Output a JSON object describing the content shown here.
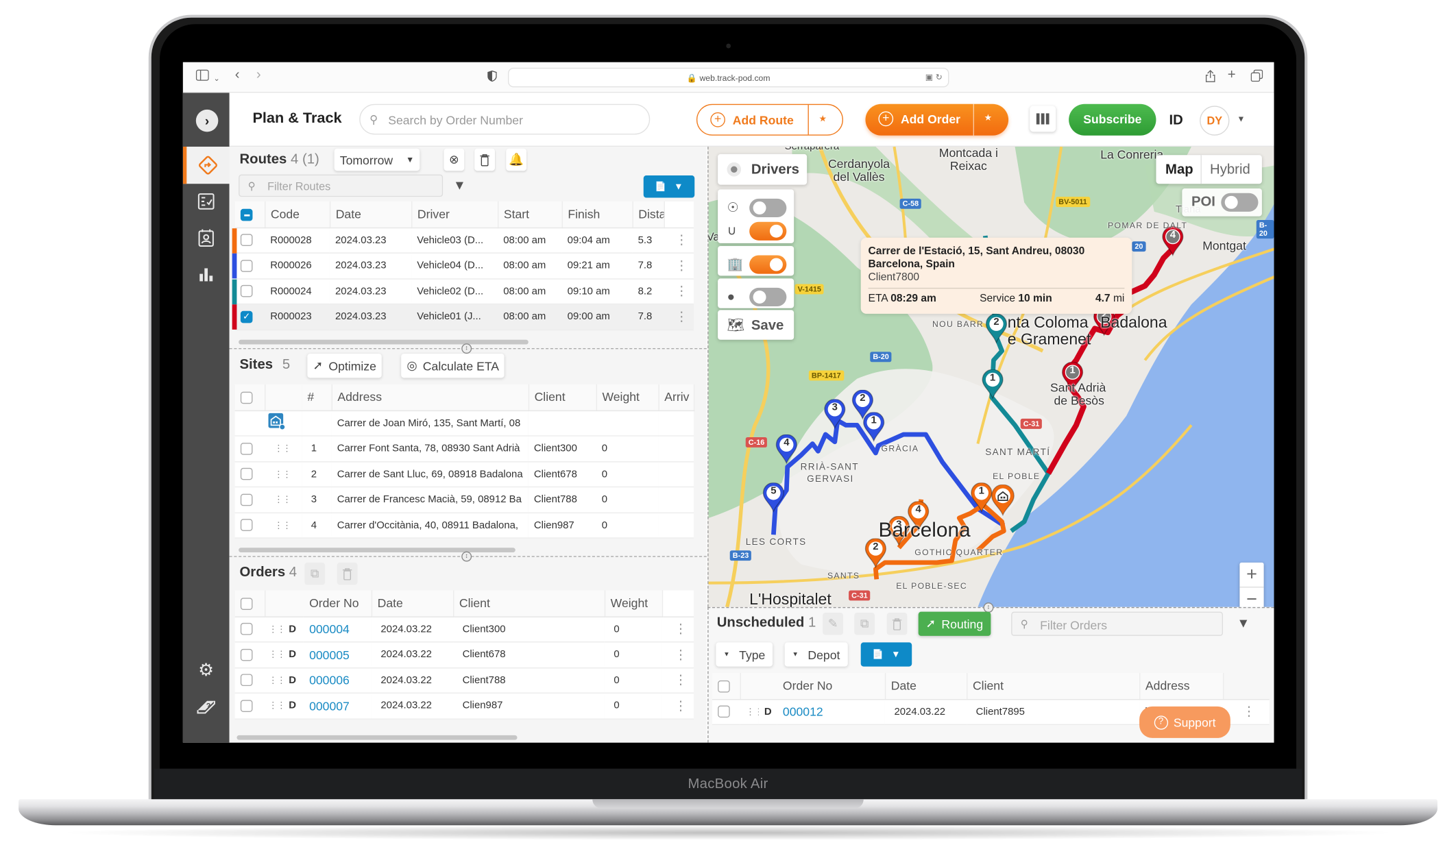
{
  "device": {
    "label": "MacBook Air"
  },
  "browser": {
    "url": "web.track-pod.com",
    "icons": [
      "sidebar-toggle-icon",
      "chevron-down-icon",
      "back-icon",
      "forward-icon",
      "privacy-shield-icon",
      "translate-icon",
      "reload-icon",
      "share-icon",
      "new-tab-icon",
      "tabs-overview-icon"
    ]
  },
  "header": {
    "title": "Plan & Track",
    "search_placeholder": "Search by Order Number",
    "add_route_label": "Add Route",
    "add_order_label": "Add Order",
    "subscribe_label": "Subscribe",
    "id_label": "ID",
    "avatar_initials": "DY",
    "accent_color": "#f07a1c",
    "subscribe_color": "#3aaa3f"
  },
  "sidebar": {
    "items": [
      {
        "name": "routes",
        "icon": "route-diamond-icon",
        "active": true
      },
      {
        "name": "checklist",
        "icon": "checklist-icon",
        "active": false
      },
      {
        "name": "contacts",
        "icon": "contact-card-icon",
        "active": false
      },
      {
        "name": "reports",
        "icon": "bar-chart-icon",
        "active": false
      }
    ],
    "bottom_items": [
      {
        "name": "settings",
        "icon": "gear-icon"
      },
      {
        "name": "help",
        "icon": "help-book-icon"
      }
    ]
  },
  "routes": {
    "title": "Routes",
    "count": "4 (1)",
    "date_filter": "Tomorrow",
    "filter_placeholder": "Filter Routes",
    "columns": [
      "Code",
      "Date",
      "Driver",
      "Start",
      "Finish",
      "Dista"
    ],
    "rows": [
      {
        "color": "#f26b0f",
        "checked": false,
        "code": "R000028",
        "date": "2024.03.23",
        "driver": "Vehicle03 (D...",
        "start": "08:00 am",
        "finish": "09:04 am",
        "distance": "5.3"
      },
      {
        "color": "#2d4fe0",
        "checked": false,
        "code": "R000026",
        "date": "2024.03.23",
        "driver": "Vehicle04 (D...",
        "start": "08:00 am",
        "finish": "09:21 am",
        "distance": "7.8"
      },
      {
        "color": "#138a96",
        "checked": false,
        "code": "R000024",
        "date": "2024.03.23",
        "driver": "Vehicle02 (D...",
        "start": "08:00 am",
        "finish": "09:10 am",
        "distance": "8.2"
      },
      {
        "color": "#d0021b",
        "checked": true,
        "code": "R000023",
        "date": "2024.03.23",
        "driver": "Vehicle01 (J...",
        "start": "08:00 am",
        "finish": "09:00 am",
        "distance": "7.8"
      }
    ]
  },
  "sites": {
    "title": "Sites",
    "count": "5",
    "optimize_label": "Optimize",
    "calculate_eta_label": "Calculate ETA",
    "columns": [
      "#",
      "Address",
      "Client",
      "Weight",
      "Arriv"
    ],
    "depot": {
      "address": "Carrer de Joan Miró, 135, Sant Martí, 08"
    },
    "rows": [
      {
        "num": "1",
        "address": "Carrer Font Santa, 78, 08930 Sant Adrià",
        "client": "Client300",
        "weight": "0"
      },
      {
        "num": "2",
        "address": "Carrer de Sant Lluc, 69, 08918 Badalona",
        "client": "Client678",
        "weight": "0"
      },
      {
        "num": "3",
        "address": "Carrer de Francesc Macià, 59, 08912 Ba",
        "client": "Client788",
        "weight": "0"
      },
      {
        "num": "4",
        "address": "Carrer d'Occitània, 40, 08911 Badalona,",
        "client": "Clien987",
        "weight": "0"
      }
    ]
  },
  "orders": {
    "title": "Orders",
    "count": "4",
    "columns": [
      "Order No",
      "Date",
      "Client",
      "Weight"
    ],
    "rows": [
      {
        "type": "D",
        "order_no": "000004",
        "date": "2024.03.22",
        "client": "Client300",
        "weight": "0"
      },
      {
        "type": "D",
        "order_no": "000005",
        "date": "2024.03.22",
        "client": "Client678",
        "weight": "0"
      },
      {
        "type": "D",
        "order_no": "000006",
        "date": "2024.03.22",
        "client": "Client788",
        "weight": "0"
      },
      {
        "type": "D",
        "order_no": "000007",
        "date": "2024.03.22",
        "client": "Clien987",
        "weight": "0"
      }
    ]
  },
  "map": {
    "drivers_label": "Drivers",
    "save_label": "Save",
    "map_type_options": [
      "Map",
      "Hybrid"
    ],
    "map_type_selected": "Map",
    "poi_label": "POI",
    "poi_enabled": false,
    "layer_toggles": [
      {
        "icon": "location-pin-icon",
        "on": false
      },
      {
        "icon": "route-path-icon",
        "on": true
      },
      {
        "icon": "warehouse-icon",
        "on": true
      },
      {
        "icon": "map-marker-icon",
        "on": false
      }
    ],
    "popup": {
      "address_line1": "Carrer de l'Estació, 15, Sant Andreu, 08030",
      "address_line2": "Barcelona, Spain",
      "client": "Client7800",
      "eta_label": "ETA",
      "eta_value": "08:29 am",
      "service_label": "Service",
      "service_value": "10 min",
      "distance_value": "4.7",
      "distance_unit": "mi"
    },
    "places": {
      "cerdanyola": "Cerdanyola del Vallès",
      "montcada": "Montcada i Reixac",
      "la_conreria": "La Conreria",
      "pomar": "POMAR DE DALT",
      "montgat": "Montgat",
      "tiana": "Tiana",
      "santa_coloma": "nta Coloma",
      "gramenet": "e Gramenet",
      "badalona": "Badalona",
      "nou_barris": "NOU BARR",
      "sant_adria": "Sant Adrià",
      "besos": "de Besòs",
      "sant_marti": "SANT MARTÍ",
      "el_poble": "EL POBLE",
      "sarria": "RRIÀ-SANT",
      "gervasi": "GERVASI",
      "gracia": "GRÀCIA",
      "les_corts": "LES CORTS",
      "barcelona": "Barcelona",
      "gothic": "GOTHIC QUARTER",
      "sants": "SANTS",
      "poble_sec": "EL POBLE-SEC",
      "hospitalet": "L'Hospitalet",
      "valles": "Vallès",
      "serraparera": "Serraparera"
    },
    "road_tags": [
      "C-58",
      "BV-5011",
      "B-20",
      "V-1415",
      "BP-1417",
      "B-20",
      "C-16",
      "C-31",
      "B-23",
      "C-31",
      "B-20",
      "20"
    ],
    "routes": [
      {
        "name": "orange",
        "color": "#f26b0f",
        "stops": [
          "1",
          "2",
          "3",
          "4"
        ]
      },
      {
        "name": "blue",
        "color": "#2d4fe0",
        "stops": [
          "1",
          "2",
          "3",
          "4",
          "5"
        ]
      },
      {
        "name": "teal",
        "color": "#138a96",
        "stops": [
          "1",
          "2"
        ]
      },
      {
        "name": "red",
        "color": "#d0021b",
        "stops": [
          "1",
          "2",
          "4"
        ]
      }
    ]
  },
  "unscheduled": {
    "title": "Unscheduled",
    "count": "1",
    "routing_label": "Routing",
    "filter_placeholder": "Filter Orders",
    "type_label": "Type",
    "depot_label": "Depot",
    "columns": [
      "Order No",
      "Date",
      "Client",
      "Address"
    ],
    "rows": [
      {
        "type": "D",
        "order_no": "000012",
        "date": "2024.03.22",
        "client": "Client7895",
        "address": "La Rambla, Ciut"
      }
    ]
  },
  "support": {
    "label": "Support"
  }
}
